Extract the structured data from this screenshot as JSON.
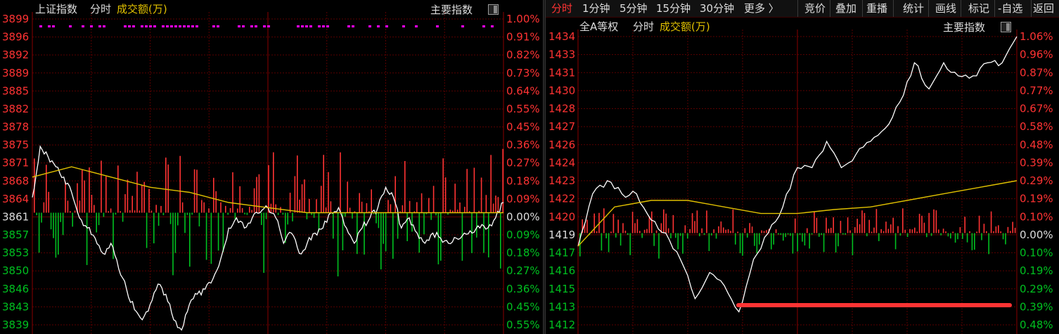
{
  "left": {
    "title": "上证指数",
    "mode": "分时",
    "volume_label": "成交额(万)",
    "main_index_label": "主要指数",
    "base_price": 3861,
    "y_prices": [
      "3899",
      "3896",
      "3892",
      "3889",
      "3885",
      "3882",
      "3878",
      "3875",
      "3871",
      "3868",
      "3864",
      "3861",
      "3857",
      "3853",
      "3850",
      "3846",
      "3843",
      "3839"
    ],
    "y_pcts": [
      "1.00%",
      "0.91%",
      "0.82%",
      "0.73%",
      "0.64%",
      "0.55%",
      "0.45%",
      "0.36%",
      "0.27%",
      "0.18%",
      "0.09%",
      "0.00%",
      "0.09%",
      "0.18%",
      "0.27%",
      "0.36%",
      "0.45%",
      "0.55%"
    ]
  },
  "right": {
    "toolbar": {
      "tabs": [
        "分时",
        "1分钟",
        "5分钟",
        "15分钟",
        "30分钟",
        "更多 〉"
      ],
      "actions": [
        "竞价",
        "叠加",
        "重播",
        "统计",
        "画线",
        "标记",
        "-自选",
        "返回"
      ]
    },
    "title": "全A等权",
    "mode": "分时",
    "volume_label": "成交额(万)",
    "main_index_label": "主要指数",
    "base_price": 1419,
    "y_prices": [
      "1434",
      "1433",
      "1431",
      "1430",
      "1428",
      "1427",
      "1426",
      "1424",
      "1423",
      "1422",
      "1420",
      "1419",
      "1417",
      "1416",
      "1415",
      "1413",
      "1412"
    ],
    "y_pcts": [
      "1.06%",
      "0.96%",
      "0.87%",
      "0.77%",
      "0.67%",
      "0.58%",
      "0.48%",
      "0.39%",
      "0.29%",
      "0.19%",
      "0.10%",
      "0.00%",
      "0.10%",
      "0.19%",
      "0.29%",
      "0.39%",
      "0.48%"
    ]
  },
  "colors": {
    "up": "#ff3333",
    "down": "#00c020",
    "price_line": "#ffffff",
    "avg_line": "#e0c000",
    "grid": "#5a0000",
    "magenta": "#ff00ff",
    "accent": "#ffcc00",
    "highlight_bar": "#ff3333"
  },
  "chart_data": [
    {
      "type": "line",
      "title": "上证指数",
      "ylim": [
        3839,
        3899
      ],
      "base": 3861,
      "series": [
        {
          "name": "分时",
          "x": [
            0,
            2,
            4,
            6,
            8,
            10,
            12,
            14,
            16,
            18,
            20,
            22,
            24,
            26,
            28,
            30,
            32,
            34,
            36,
            38,
            40,
            42,
            44,
            46,
            48,
            50,
            52,
            54,
            56,
            58,
            60,
            62,
            64,
            66,
            68,
            70,
            72,
            74,
            76,
            78,
            80,
            82,
            84,
            86,
            88,
            90,
            92,
            94,
            96,
            98,
            100,
            102,
            104,
            106,
            108,
            110,
            112,
            114,
            116,
            118,
            120
          ],
          "values": [
            3864,
            3874,
            3872,
            3870,
            3868,
            3865,
            3860,
            3858,
            3856,
            3853,
            3855,
            3850,
            3846,
            3842,
            3840,
            3843,
            3847,
            3845,
            3840,
            3838,
            3843,
            3845,
            3846,
            3848,
            3852,
            3858,
            3860,
            3858,
            3860,
            3861,
            3862,
            3860,
            3855,
            3857,
            3853,
            3855,
            3857,
            3858,
            3861,
            3862,
            3858,
            3855,
            3858,
            3860,
            3862,
            3866,
            3864,
            3858,
            3860,
            3857,
            3855,
            3857,
            3856,
            3855,
            3856,
            3857,
            3857,
            3858,
            3858,
            3860,
            3863
          ]
        },
        {
          "name": "均价",
          "x": [
            0,
            10,
            20,
            30,
            40,
            50,
            60,
            70,
            80,
            90,
            100,
            110,
            120
          ],
          "values": [
            3868,
            3870,
            3868,
            3866,
            3865,
            3863,
            3862,
            3861,
            3861,
            3861,
            3861,
            3861,
            3861
          ]
        }
      ]
    },
    {
      "type": "line",
      "title": "全A等权",
      "ylim": [
        1412,
        1434
      ],
      "base": 1419,
      "series": [
        {
          "name": "分时",
          "x": [
            0,
            4,
            8,
            12,
            16,
            20,
            24,
            28,
            32,
            36,
            40,
            44,
            48,
            52,
            56,
            60,
            64,
            68,
            72,
            76,
            80,
            84,
            88,
            92,
            96,
            100,
            104,
            108,
            112,
            116,
            120
          ],
          "values": [
            1418,
            1422,
            1423,
            1422,
            1422,
            1420,
            1419,
            1417,
            1414,
            1416,
            1415,
            1413,
            1417,
            1419,
            1421,
            1424,
            1424,
            1426,
            1424,
            1425,
            1426,
            1427,
            1429,
            1432,
            1430,
            1432,
            1431,
            1431,
            1432,
            1432,
            1434
          ]
        },
        {
          "name": "均价",
          "x": [
            0,
            10,
            20,
            30,
            40,
            50,
            60,
            70,
            80,
            90,
            100,
            110,
            120
          ],
          "values": [
            1418,
            1421,
            1421.5,
            1421.5,
            1421,
            1420.5,
            1420.5,
            1420.8,
            1421,
            1421.5,
            1422,
            1422.5,
            1423
          ]
        }
      ]
    }
  ]
}
